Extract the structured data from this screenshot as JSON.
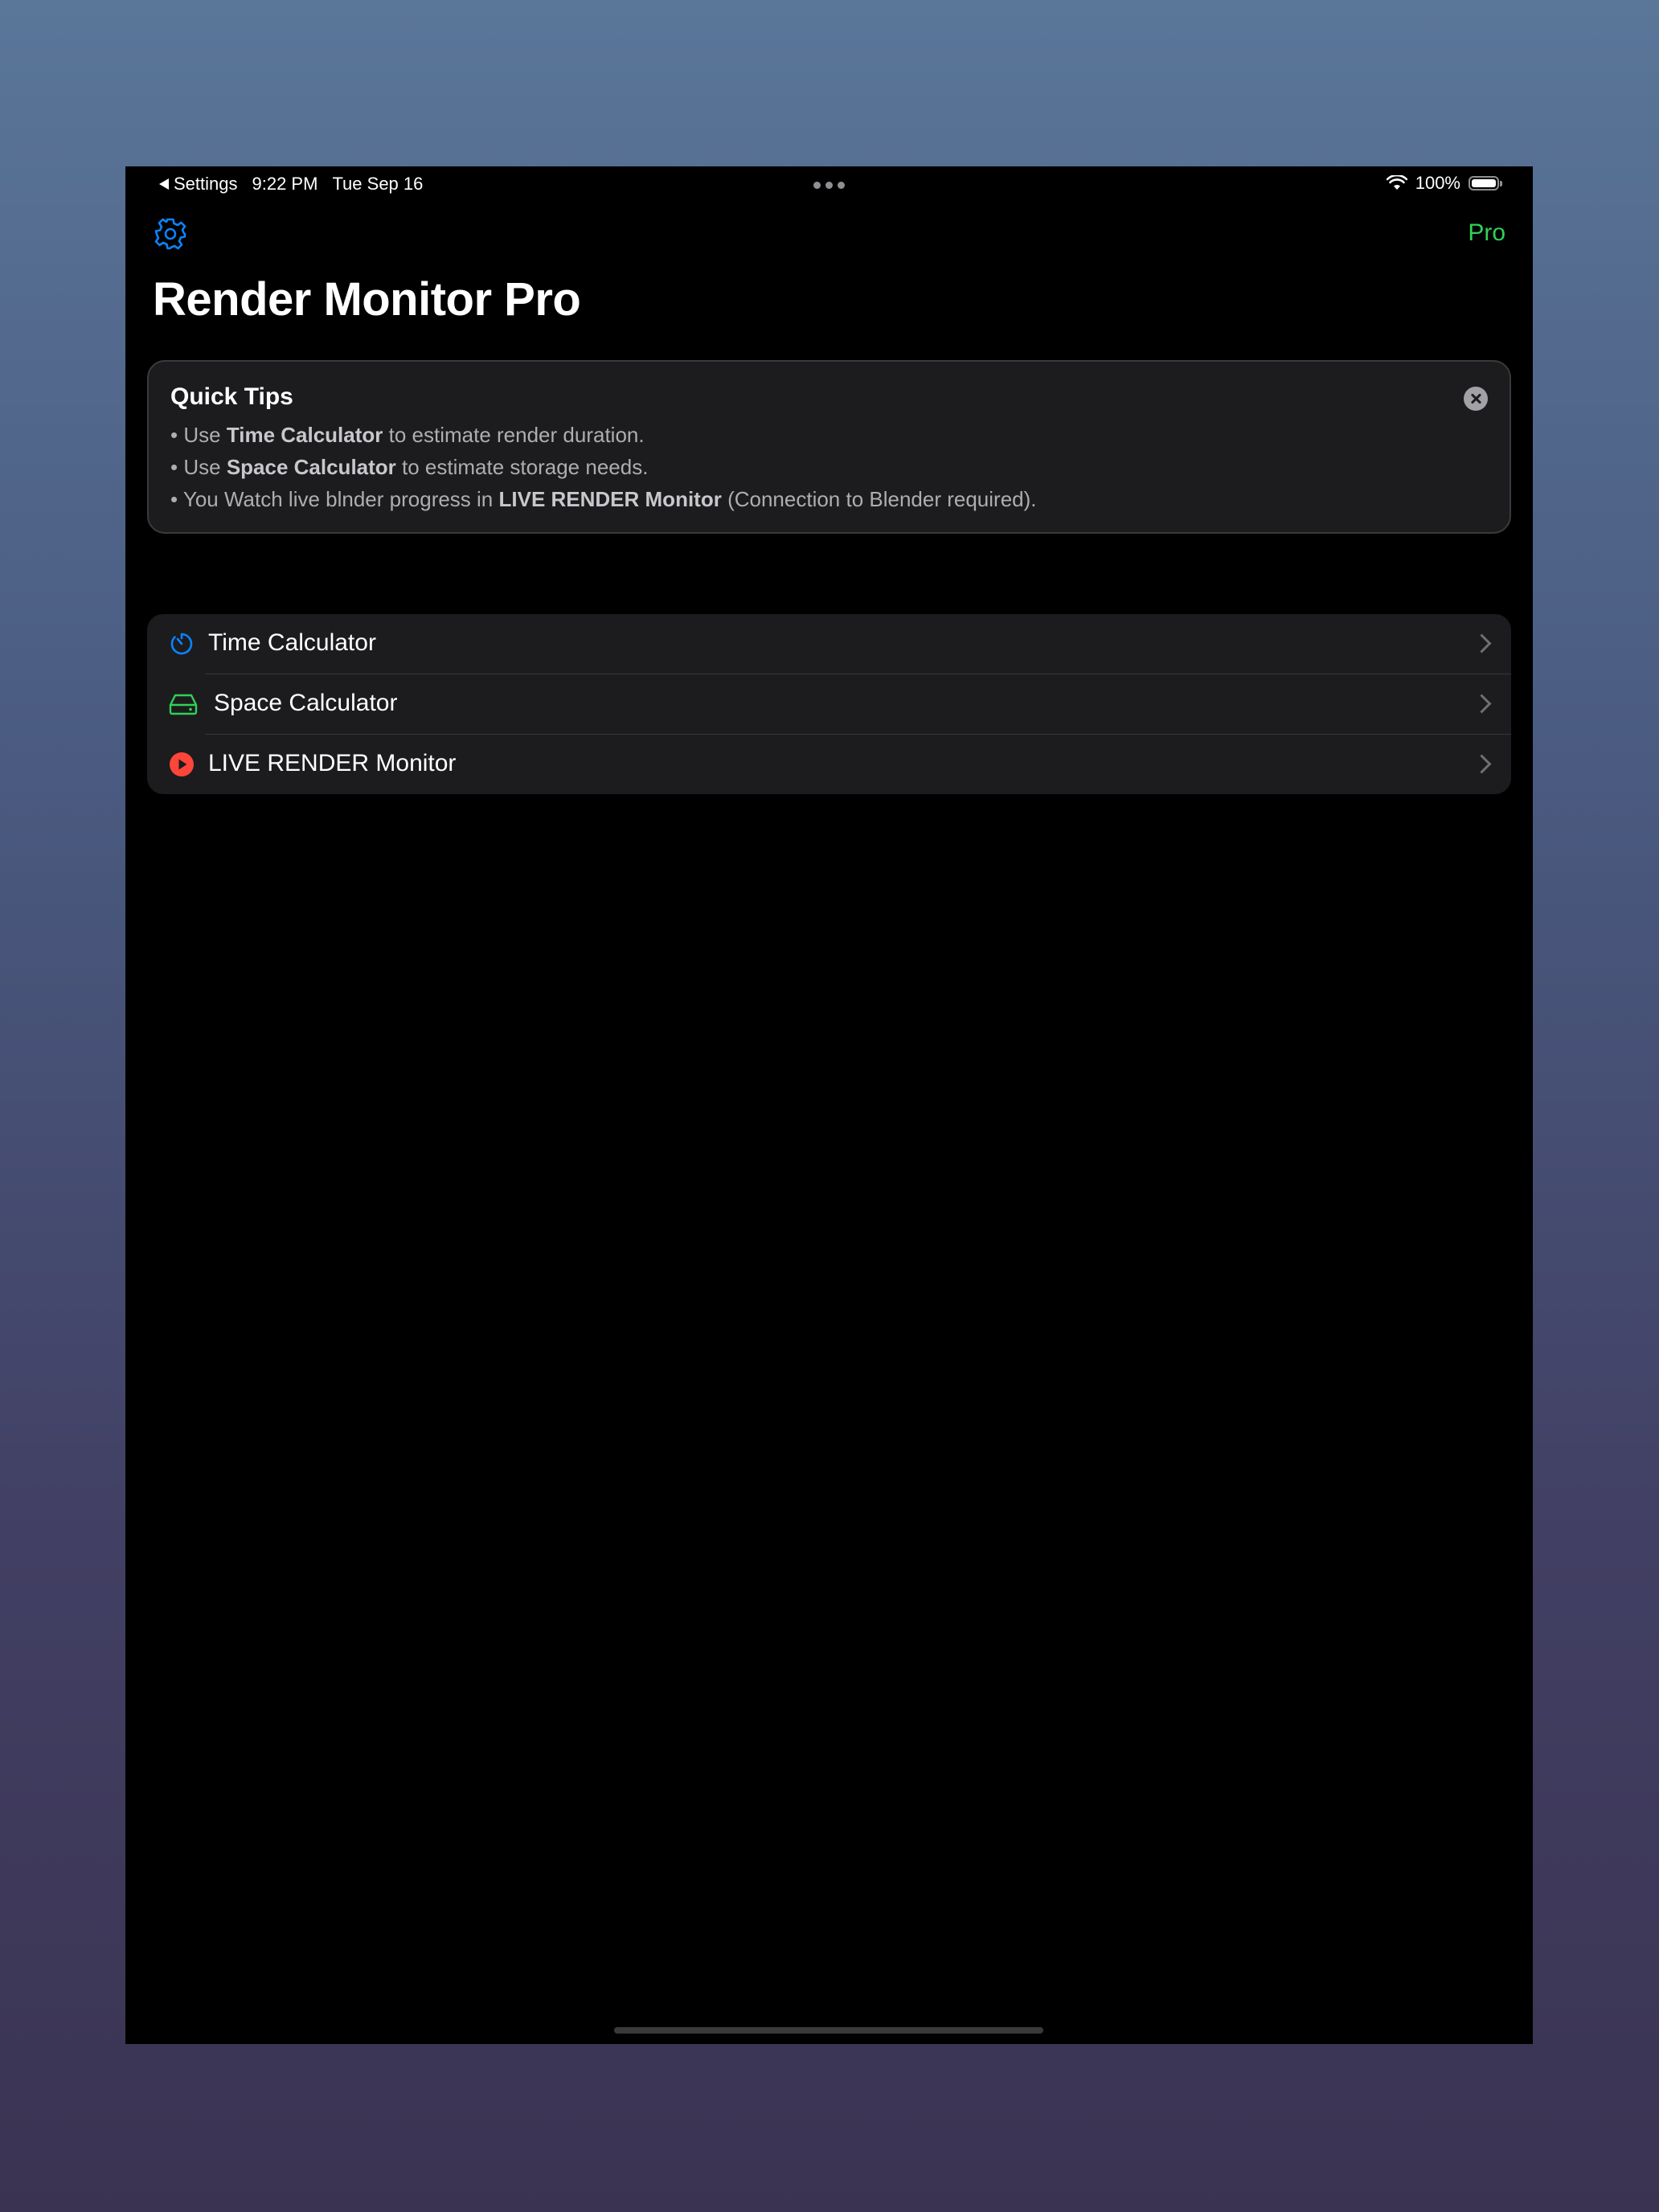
{
  "status_bar": {
    "back_label": "Settings",
    "time": "9:22 PM",
    "date": "Tue Sep 16",
    "battery": "100%"
  },
  "nav": {
    "settings_icon": "gear-icon",
    "pro_label": "Pro",
    "title": "Render Monitor Pro"
  },
  "tips": {
    "title": "Quick Tips",
    "close_icon": "close-icon",
    "lines": [
      {
        "bullet": "•",
        "pre": "Use ",
        "bold": "Time Calculator",
        "post": " to estimate render duration."
      },
      {
        "bullet": "•",
        "pre": "Use ",
        "bold": "Space Calculator",
        "post": " to estimate storage needs."
      },
      {
        "bullet": "•",
        "pre": "You Watch live blnder progress in ",
        "bold": "LIVE RENDER Monitor",
        "post": " (Connection to Blender required)."
      }
    ]
  },
  "menu": {
    "items": [
      {
        "label": "Time Calculator",
        "icon": "timer-icon",
        "color": "#0a84ff"
      },
      {
        "label": "Space Calculator",
        "icon": "drive-icon",
        "color": "#30d158"
      },
      {
        "label": "LIVE RENDER Monitor",
        "icon": "play-circle-icon",
        "color": "#ff453a"
      }
    ]
  },
  "colors": {
    "accent_blue": "#0a84ff",
    "accent_green": "#30d158",
    "accent_red": "#ff453a"
  }
}
